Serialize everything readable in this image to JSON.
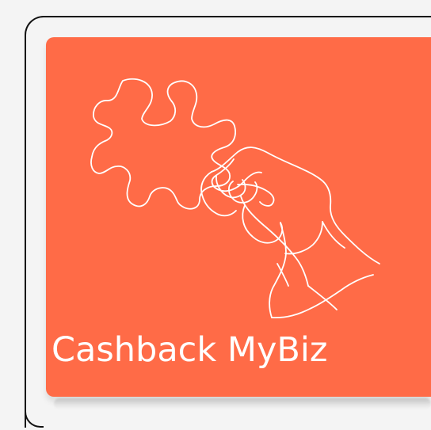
{
  "app": {
    "label": "Cashback MyBiz"
  },
  "theme": {
    "background": "#f4f4f4",
    "card": "#ff6b47",
    "line_art": "#ffffff",
    "frame": "#111111"
  },
  "icons": {
    "main": "puzzle-hand-icon"
  }
}
